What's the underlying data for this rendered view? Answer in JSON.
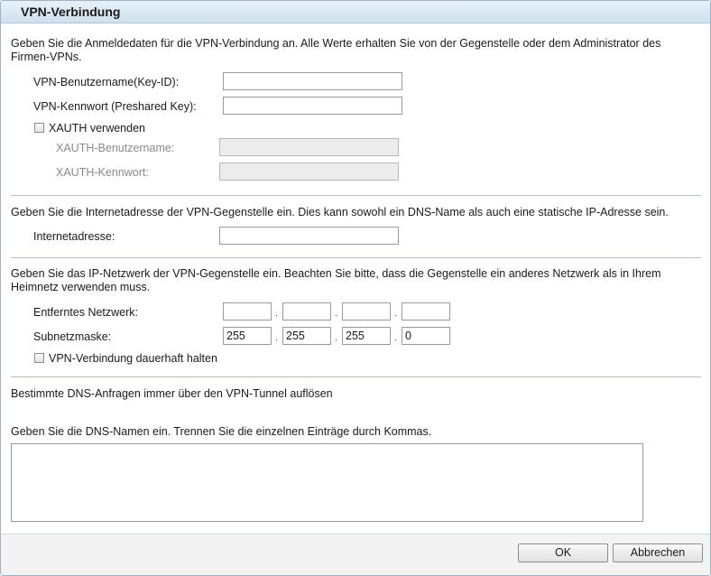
{
  "dialog": {
    "title": "VPN-Verbindung"
  },
  "credentials": {
    "intro": "Geben Sie die Anmeldedaten für die VPN-Verbindung an. Alle Werte erhalten Sie von der Gegenstelle oder dem Administrator des Firmen-VPNs.",
    "username_label": "VPN-Benutzername(Key-ID):",
    "username_value": "",
    "password_label": "VPN-Kennwort (Preshared Key):",
    "password_value": "",
    "xauth_label": "XAUTH verwenden",
    "xauth_checked": false,
    "xauth_user_label": "XAUTH-Benutzername:",
    "xauth_pass_label": "XAUTH-Kennwort:"
  },
  "remote": {
    "intro": "Geben Sie die Internetadresse der VPN-Gegenstelle ein. Dies kann sowohl ein DNS-Name als auch eine statische IP-Adresse sein.",
    "address_label": "Internetadresse:",
    "address_value": ""
  },
  "network": {
    "intro": "Geben Sie das IP-Netzwerk der VPN-Gegenstelle ein. Beachten Sie bitte, dass die Gegenstelle ein anderes Netzwerk als in Ihrem Heimnetz verwenden muss.",
    "remote_network_label": "Entferntes Netzwerk:",
    "remote_network": [
      "",
      "",
      "",
      ""
    ],
    "subnet_label": "Subnetzmaske:",
    "subnet": [
      "255",
      "255",
      "255",
      "0"
    ],
    "dot": ".",
    "keepalive_label": "VPN-Verbindung dauerhaft halten",
    "keepalive_checked": false
  },
  "dns": {
    "heading": "Bestimmte DNS-Anfragen immer über den VPN-Tunnel auflösen",
    "instructions": "Geben Sie die DNS-Namen ein. Trennen Sie die einzelnen Einträge durch Kommas.",
    "names_value": ""
  },
  "buttons": {
    "ok": "OK",
    "cancel": "Abbrechen"
  }
}
